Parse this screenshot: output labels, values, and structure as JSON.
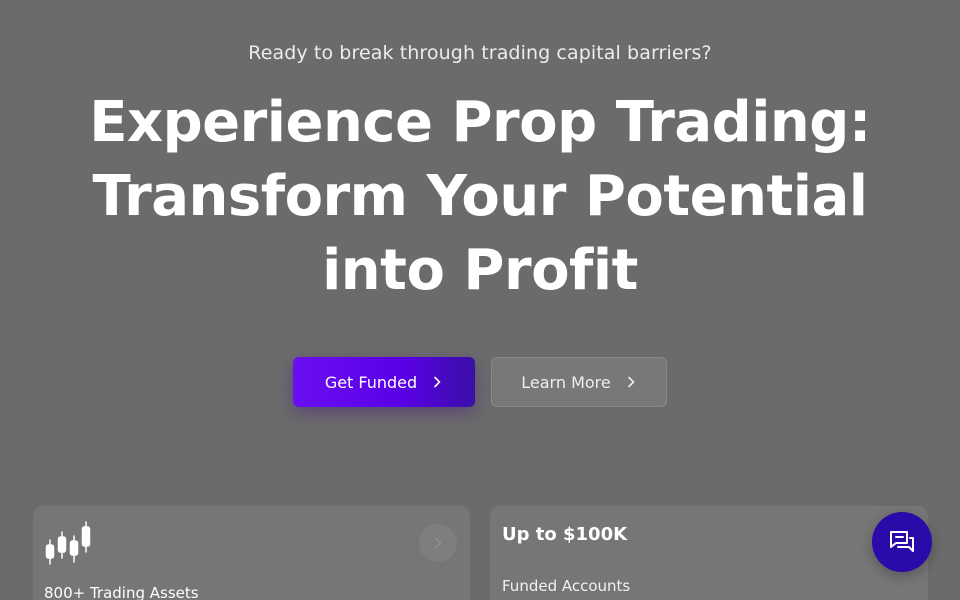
{
  "hero": {
    "eyebrow": "Ready to break through trading capital barriers?",
    "headline": "Experience Prop Trading: Transform Your Potential into Profit"
  },
  "cta": {
    "primary_label": "Get Funded",
    "secondary_label": "Learn More"
  },
  "cards": {
    "assets": {
      "label": "800+ Trading Assets",
      "icon": "candlestick-chart-icon"
    },
    "funding": {
      "title": "Up to $100K",
      "label": "Funded Accounts"
    }
  },
  "chat": {
    "icon": "chat-bubbles-icon"
  },
  "colors": {
    "background": "#6b6b6b",
    "primary_button": "#5a00e6",
    "chat_button": "#2a0aa8"
  }
}
